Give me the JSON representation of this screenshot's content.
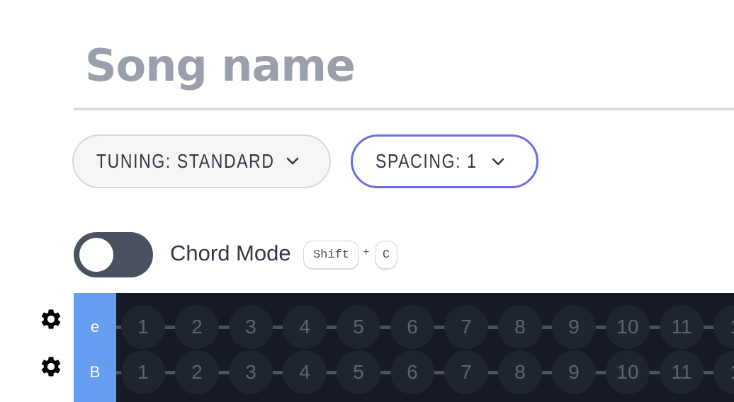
{
  "song": {
    "title": "Song name"
  },
  "controls": {
    "tuning_label": "TUNING: STANDARD",
    "spacing_label": "SPACING: 1"
  },
  "chord_mode": {
    "label": "Chord Mode",
    "enabled": false,
    "shortcut_keys": [
      "Shift",
      "C"
    ],
    "shortcut_plus": "+"
  },
  "fretboard": {
    "strings": [
      {
        "name": "e",
        "frets": [
          "1",
          "2",
          "3",
          "4",
          "5",
          "6",
          "7",
          "8",
          "9",
          "10",
          "11",
          "1"
        ]
      },
      {
        "name": "B",
        "frets": [
          "1",
          "2",
          "3",
          "4",
          "5",
          "6",
          "7",
          "8",
          "9",
          "10",
          "11",
          "1"
        ]
      }
    ]
  },
  "colors": {
    "accent": "#6a6ee0",
    "string_label_bg": "#669df0",
    "fretboard_bg": "#151a25"
  },
  "icons": {
    "dropdown": "chevron-down-icon",
    "string_settings": "gear-icon"
  }
}
